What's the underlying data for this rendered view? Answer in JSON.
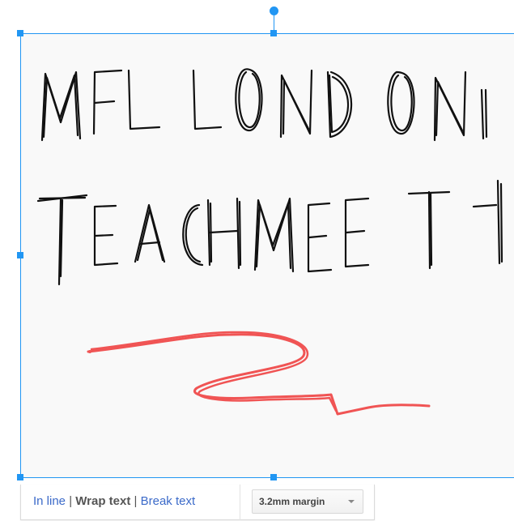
{
  "drawing": {
    "handwritten_line_1": "MFL LONDON",
    "handwritten_line_2": "TEACHMEET",
    "ink_color": "#111111",
    "squiggle_color": "#f05454"
  },
  "selection": {
    "accent_color": "#2196f3"
  },
  "wrap_toolbar": {
    "in_line": "In line",
    "wrap_text": "Wrap text",
    "break_text": "Break text",
    "separator": "|",
    "margin_value": "3.2mm margin",
    "link_color": "#3b6ac9"
  }
}
